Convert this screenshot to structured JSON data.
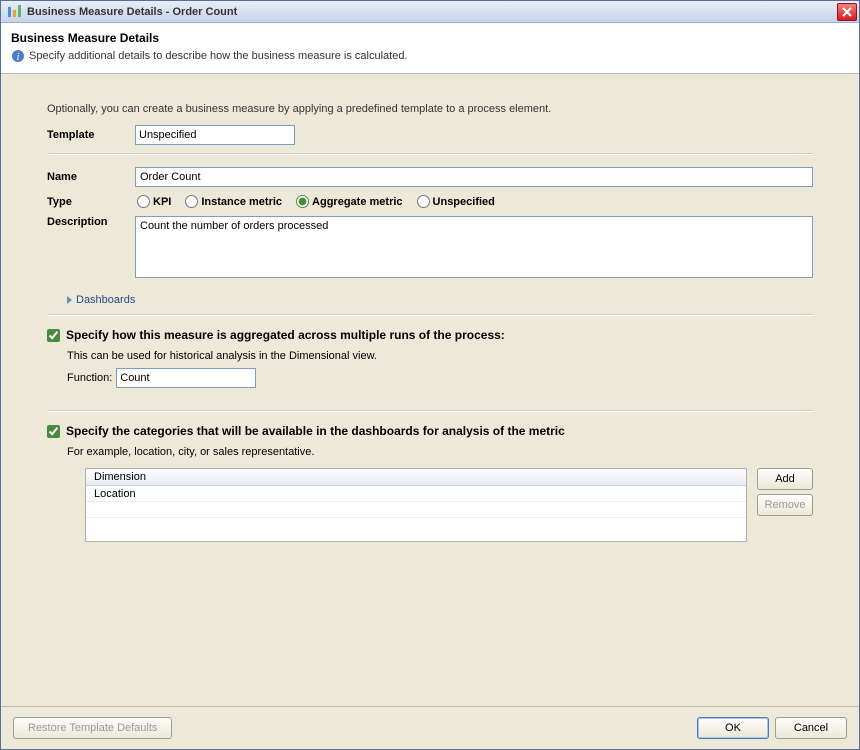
{
  "window": {
    "title": "Business Measure Details - Order Count"
  },
  "header": {
    "title": "Business Measure Details",
    "subtitle": "Specify additional details to describe how the business measure is calculated."
  },
  "intro": {
    "hint": "Optionally, you can create a business measure by applying a predefined template to a process element.",
    "template_label": "Template",
    "template_value": "Unspecified"
  },
  "fields": {
    "name_label": "Name",
    "name_value": "Order Count",
    "type_label": "Type",
    "type_options": {
      "kpi": "KPI",
      "instance": "Instance metric",
      "aggregate": "Aggregate metric",
      "unspecified": "Unspecified"
    },
    "type_selected": "aggregate",
    "description_label": "Description",
    "description_value": "Count the number of orders processed"
  },
  "disclosure": {
    "dashboards": "Dashboards"
  },
  "aggregation": {
    "checkbox_label": "Specify how this measure is aggregated across multiple runs of the process:",
    "checked": true,
    "hint": "This can be used for historical analysis in the Dimensional view.",
    "function_label": "Function:",
    "function_value": "Count"
  },
  "categories": {
    "checkbox_label": "Specify the categories that will be available in the dashboards for analysis of the metric",
    "checked": true,
    "hint": "For example, location, city, or sales representative.",
    "column_header": "Dimension",
    "rows": [
      "Location"
    ],
    "add_label": "Add",
    "remove_label": "Remove"
  },
  "footer": {
    "restore": "Restore Template Defaults",
    "ok": "OK",
    "cancel": "Cancel"
  }
}
